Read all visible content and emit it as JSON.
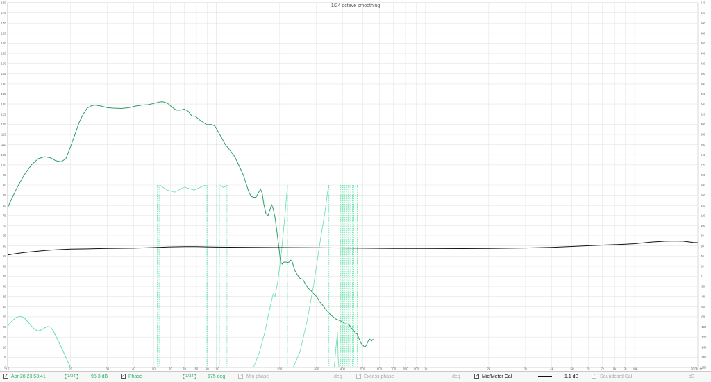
{
  "chart_data": {
    "type": "line",
    "title": "1/24 octave smoothing",
    "x_scale": "log",
    "xlim": [
      10,
      20000
    ],
    "ylim_left": [
      0,
      180
    ],
    "ylim_right": [
      -180,
      540
    ],
    "grid": true,
    "x_ticks": [
      {
        "v": 10,
        "t": "10"
      },
      {
        "v": 20,
        "t": "20"
      },
      {
        "v": 30,
        "t": "30"
      },
      {
        "v": 40,
        "t": "40"
      },
      {
        "v": 50,
        "t": "50"
      },
      {
        "v": 60,
        "t": "60"
      },
      {
        "v": 70,
        "t": "70"
      },
      {
        "v": 80,
        "t": "80"
      },
      {
        "v": 90,
        "t": "90"
      },
      {
        "v": 100,
        "t": "100"
      },
      {
        "v": 200,
        "t": "200"
      },
      {
        "v": 300,
        "t": "300"
      },
      {
        "v": 400,
        "t": "400"
      },
      {
        "v": 500,
        "t": "500"
      },
      {
        "v": 600,
        "t": "600"
      },
      {
        "v": 700,
        "t": "700"
      },
      {
        "v": 800,
        "t": "800"
      },
      {
        "v": 900,
        "t": "900"
      },
      {
        "v": 1000,
        "t": "1k"
      },
      {
        "v": 2000,
        "t": "2k"
      },
      {
        "v": 3000,
        "t": "3k"
      },
      {
        "v": 4000,
        "t": "4k"
      },
      {
        "v": 5000,
        "t": "5k"
      },
      {
        "v": 6000,
        "t": "6k"
      },
      {
        "v": 7000,
        "t": "7k"
      },
      {
        "v": 8000,
        "t": "8k"
      },
      {
        "v": 9000,
        "t": "9k"
      },
      {
        "v": 10000,
        "t": "10k"
      },
      {
        "v": 20000,
        "t": "20.0k Hz"
      }
    ],
    "y_ticks_left": [
      "0",
      "5",
      "10",
      "15",
      "20",
      "25",
      "30",
      "35",
      "40",
      "45",
      "50",
      "55",
      "60",
      "65",
      "70",
      "75",
      "80",
      "85",
      "90",
      "95",
      "100",
      "105",
      "110",
      "115",
      "120",
      "125",
      "130",
      "135",
      "140",
      "145",
      "150",
      "155",
      "160",
      "165",
      "170",
      "175",
      "180"
    ],
    "y_ticks_right": [
      "-180",
      "-160",
      "-140",
      "-120",
      "-100",
      "-80",
      "-60",
      "-40",
      "-20",
      "0",
      "20",
      "40",
      "60",
      "80",
      "100",
      "120",
      "140",
      "160",
      "180",
      "200",
      "220",
      "240",
      "260",
      "280",
      "300",
      "320",
      "340",
      "360",
      "380",
      "400",
      "420",
      "440",
      "460",
      "480",
      "500",
      "520",
      "540"
    ],
    "series": [
      {
        "name": "Apr 28 23:53:41",
        "color": "#2a9d66",
        "points": [
          [
            10,
            79
          ],
          [
            11,
            88
          ],
          [
            12,
            95
          ],
          [
            13,
            100
          ],
          [
            14,
            103
          ],
          [
            15,
            104
          ],
          [
            16,
            103.5
          ],
          [
            17,
            102
          ],
          [
            18,
            101.5
          ],
          [
            19,
            103
          ],
          [
            20,
            109
          ],
          [
            21,
            115
          ],
          [
            22,
            121
          ],
          [
            23,
            125
          ],
          [
            24,
            128
          ],
          [
            25,
            129
          ],
          [
            26,
            129.5
          ],
          [
            27,
            129.3
          ],
          [
            28,
            129
          ],
          [
            30,
            128.2
          ],
          [
            32,
            128
          ],
          [
            35,
            127.8
          ],
          [
            38,
            128.2
          ],
          [
            41,
            129
          ],
          [
            44,
            129.5
          ],
          [
            47,
            129.7
          ],
          [
            50,
            130.3
          ],
          [
            53,
            131
          ],
          [
            55,
            131.2
          ],
          [
            58,
            130.5
          ],
          [
            61,
            128.6
          ],
          [
            64,
            127
          ],
          [
            67,
            127
          ],
          [
            70,
            127.5
          ],
          [
            73,
            126.5
          ],
          [
            76,
            124
          ],
          [
            79,
            124
          ],
          [
            82,
            122.5
          ],
          [
            86,
            121
          ],
          [
            90,
            119.8
          ],
          [
            94,
            119.9
          ],
          [
            98,
            119.2
          ],
          [
            102,
            116
          ],
          [
            106,
            113
          ],
          [
            110,
            110
          ],
          [
            114,
            108
          ],
          [
            118,
            106
          ],
          [
            122,
            104
          ],
          [
            126,
            101
          ],
          [
            130,
            98
          ],
          [
            134,
            95
          ],
          [
            138,
            91
          ],
          [
            142,
            87
          ],
          [
            146,
            84.5
          ],
          [
            150,
            84
          ],
          [
            154,
            84
          ],
          [
            158,
            86
          ],
          [
            162,
            88
          ],
          [
            165,
            86
          ],
          [
            168,
            80.5
          ],
          [
            172,
            76
          ],
          [
            176,
            75
          ],
          [
            180,
            78
          ],
          [
            183,
            80.5
          ],
          [
            186,
            78.5
          ],
          [
            190,
            74
          ],
          [
            194,
            67
          ],
          [
            198,
            60
          ],
          [
            202,
            52
          ],
          [
            206,
            51
          ],
          [
            210,
            52
          ],
          [
            214,
            52
          ],
          [
            218,
            51.8
          ],
          [
            222,
            52
          ],
          [
            226,
            53
          ],
          [
            230,
            52
          ],
          [
            236,
            48
          ],
          [
            242,
            46
          ],
          [
            250,
            44
          ],
          [
            258,
            43.5
          ],
          [
            266,
            41
          ],
          [
            274,
            39
          ],
          [
            282,
            38
          ],
          [
            290,
            36.5
          ],
          [
            300,
            35
          ],
          [
            310,
            32.5
          ],
          [
            320,
            31
          ],
          [
            330,
            29
          ],
          [
            340,
            27.5
          ],
          [
            350,
            26
          ],
          [
            360,
            25
          ],
          [
            370,
            24
          ],
          [
            380,
            23.5
          ],
          [
            390,
            23
          ],
          [
            400,
            22.5
          ],
          [
            410,
            21.5
          ],
          [
            420,
            21.5
          ],
          [
            430,
            21
          ],
          [
            440,
            19.5
          ],
          [
            450,
            18.5
          ],
          [
            460,
            17
          ],
          [
            470,
            16.5
          ],
          [
            480,
            14
          ],
          [
            490,
            12
          ],
          [
            500,
            11
          ],
          [
            510,
            10
          ],
          [
            520,
            11
          ],
          [
            530,
            13
          ],
          [
            540,
            14
          ],
          [
            550,
            13
          ],
          [
            560,
            14
          ]
        ]
      },
      {
        "name": "Phase",
        "color": "#5fe0a8",
        "axis": "right",
        "points": [
          [
            10,
            -98
          ],
          [
            10.5,
            -88
          ],
          [
            11,
            -81
          ],
          [
            11.5,
            -79
          ],
          [
            12,
            -82
          ],
          [
            12.5,
            -90
          ],
          [
            13,
            -98
          ],
          [
            13.5,
            -105
          ],
          [
            14,
            -108
          ],
          [
            14.5,
            -106
          ],
          [
            15,
            -102
          ],
          [
            15.5,
            -99
          ],
          [
            16,
            -100
          ],
          [
            16.5,
            -107
          ],
          [
            17,
            -118
          ],
          [
            17.5,
            -129
          ],
          [
            18,
            -139
          ],
          [
            18.5,
            -150
          ],
          [
            19,
            -160
          ],
          [
            19.5,
            -170
          ],
          [
            20,
            -180
          ]
        ]
      },
      {
        "name": "Mic/Meter Cal",
        "color": "#111111",
        "points": [
          [
            10,
            55.5
          ],
          [
            11,
            56.2
          ],
          [
            12,
            56.7
          ],
          [
            13,
            57.1
          ],
          [
            14,
            57.4
          ],
          [
            15,
            57.7
          ],
          [
            16,
            57.9
          ],
          [
            17,
            58.1
          ],
          [
            18,
            58.2
          ],
          [
            20,
            58.4
          ],
          [
            25,
            58.6
          ],
          [
            30,
            58.8
          ],
          [
            40,
            58.9
          ],
          [
            50,
            59.2
          ],
          [
            60,
            59.5
          ],
          [
            70,
            59.6
          ],
          [
            80,
            59.6
          ],
          [
            90,
            59.5
          ],
          [
            100,
            59.4
          ],
          [
            150,
            59.3
          ],
          [
            200,
            59.2
          ],
          [
            300,
            59.1
          ],
          [
            500,
            58.9
          ],
          [
            700,
            58.8
          ],
          [
            1000,
            58.8
          ],
          [
            1500,
            58.7
          ],
          [
            2000,
            58.8
          ],
          [
            3000,
            59.0
          ],
          [
            4000,
            59.3
          ],
          [
            5000,
            59.7
          ],
          [
            6000,
            60.1
          ],
          [
            7000,
            60.4
          ],
          [
            8000,
            60.6
          ],
          [
            9000,
            60.8
          ],
          [
            10000,
            61.1
          ],
          [
            11000,
            61.5
          ],
          [
            12000,
            61.9
          ],
          [
            13000,
            62.1
          ],
          [
            14000,
            62.3
          ],
          [
            15000,
            62.4
          ],
          [
            16000,
            62.4
          ],
          [
            17000,
            62.3
          ],
          [
            18000,
            62.0
          ],
          [
            19000,
            61.7
          ],
          [
            20000,
            61.6
          ]
        ]
      }
    ]
  },
  "legend": {
    "measurement_name": "Apr 28 23:53:41",
    "measurement_smoothing": "1/24",
    "measurement_value": "95.3 dB",
    "phase_label": "Phase",
    "phase_smoothing": "1/24",
    "phase_value": "175 deg",
    "min_phase_label": "Min phase",
    "min_phase_unit": "deg",
    "excess_phase_label": "Excess phase",
    "excess_phase_unit": "deg",
    "mic_label": "Mic/Meter Cal",
    "mic_value": "1.1 dB",
    "soundcard_label": "Soundcard Cal",
    "soundcard_unit": "dB"
  }
}
